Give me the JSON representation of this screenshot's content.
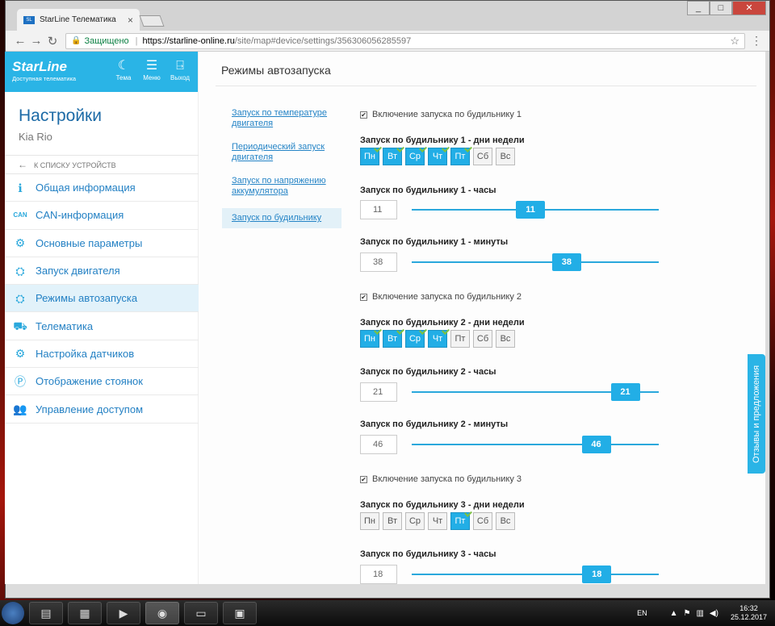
{
  "browser": {
    "tab_title": "StarLine Телематика",
    "tab_close": "×",
    "secure_label": "Защищено",
    "url_host": "https://starline-online.ru",
    "url_rest": "/site/map#device/settings/356306056285597",
    "window_min": "_",
    "window_max": "□",
    "window_close": "✕"
  },
  "header": {
    "logo": "StarLine",
    "logo_sub": "Доступная телематика",
    "theme_label": "Тема",
    "menu_label": "Меню",
    "exit_label": "Выход"
  },
  "sidebar": {
    "title": "Настройки",
    "device": "Kia Rio",
    "back_label": "К списку устройств",
    "items": [
      {
        "label": "Общая информация",
        "icon": "info-icon"
      },
      {
        "label": "CAN-информация",
        "icon": "can-icon"
      },
      {
        "label": "Основные параметры",
        "icon": "gear-icon"
      },
      {
        "label": "Запуск двигателя",
        "icon": "engine-icon"
      },
      {
        "label": "Режимы автозапуска",
        "icon": "autostart-icon"
      },
      {
        "label": "Телематика",
        "icon": "car-icon"
      },
      {
        "label": "Настройка датчиков",
        "icon": "sensors-icon"
      },
      {
        "label": "Отображение стоянок",
        "icon": "parking-icon"
      },
      {
        "label": "Управление доступом",
        "icon": "users-icon"
      }
    ]
  },
  "main": {
    "title": "Режимы автозапуска",
    "subnav": [
      "Запуск по температуре двигателя",
      "Периодический запуск двигателя",
      "Запуск по напряжению аккумулятора",
      "Запуск по будильнику"
    ],
    "alarms": [
      {
        "enable_label": "Включение запуска по будильнику 1",
        "days_label": "Запуск по будильнику 1 - дни недели",
        "hours_label": "Запуск по будильнику 1 - часы",
        "hours_value": "11",
        "minutes_label": "Запуск по будильнику 1 - минуты",
        "minutes_value": "38"
      },
      {
        "enable_label": "Включение запуска по будильнику 2",
        "days_label": "Запуск по будильнику 2 - дни недели",
        "hours_label": "Запуск по будильнику 2 - часы",
        "hours_value": "21",
        "minutes_label": "Запуск по будильнику 2 - минуты",
        "minutes_value": "46"
      },
      {
        "enable_label": "Включение запуска по будильнику 3",
        "days_label": "Запуск по будильнику 3 - дни недели",
        "hours_label": "Запуск по будильнику 3 - часы",
        "hours_value": "18"
      }
    ],
    "days": [
      "Пн",
      "Вт",
      "Ср",
      "Чт",
      "Пт",
      "Сб",
      "Вс"
    ],
    "alarm1_days_on": [
      true,
      true,
      true,
      true,
      true,
      false,
      false
    ],
    "alarm2_days_on": [
      true,
      true,
      true,
      true,
      false,
      false,
      false
    ],
    "alarm3_days_on": [
      false,
      false,
      false,
      false,
      true,
      false,
      false
    ],
    "hours_max": 23,
    "minutes_max": 59
  },
  "feedback_label": "Отзывы и предложения",
  "taskbar": {
    "lang": "EN",
    "time": "16:32",
    "date": "25.12.2017"
  },
  "colors": {
    "accent": "#22aee6",
    "link": "#2584c6"
  }
}
